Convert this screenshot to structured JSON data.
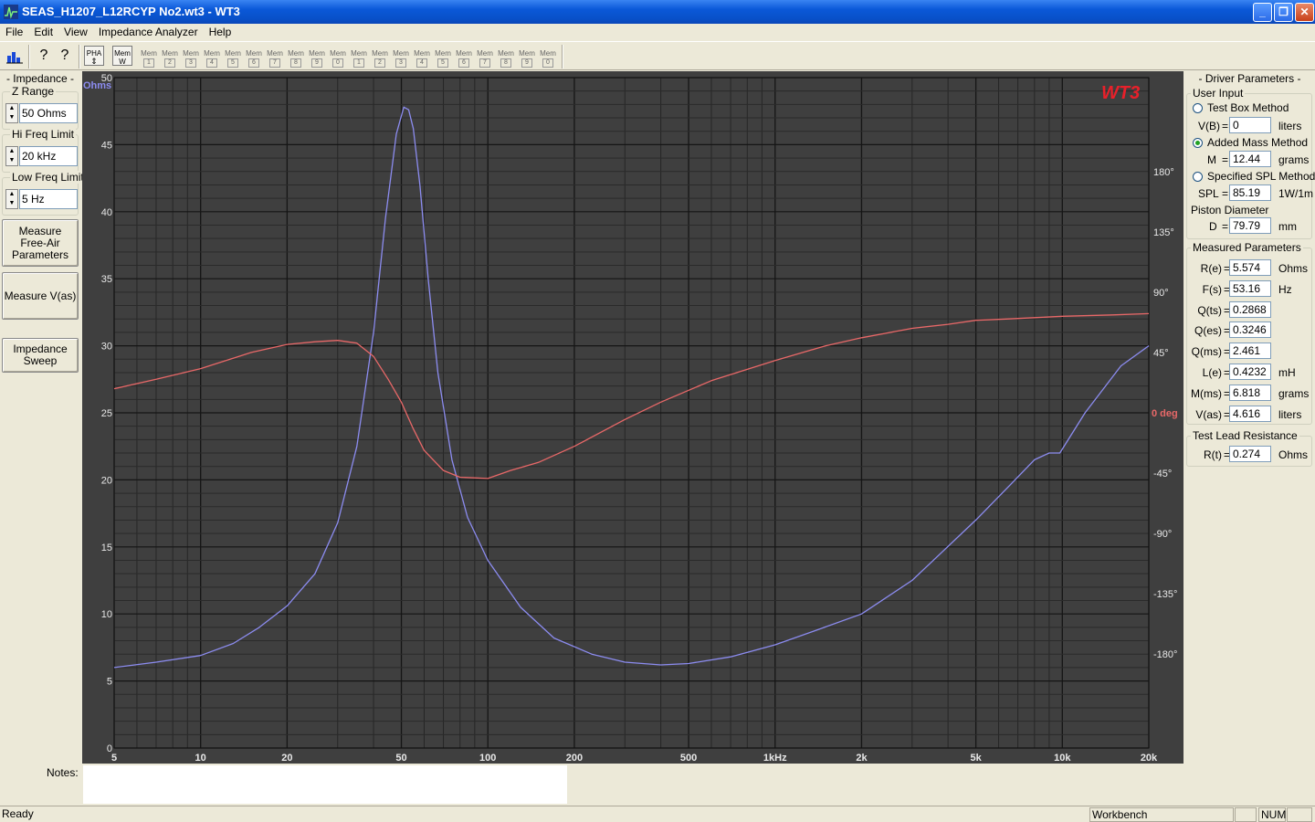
{
  "window": {
    "title": "SEAS_H1207_L12RCYP No2.wt3 - WT3",
    "controls": {
      "minimize": "_",
      "maximize": "❐",
      "close": "✕"
    }
  },
  "menu": [
    "File",
    "Edit",
    "View",
    "Impedance Analyzer",
    "Help"
  ],
  "toolbar": {
    "buttons": [
      {
        "name": "chart-icon",
        "label": ""
      },
      {
        "name": "help-icon",
        "label": "?"
      },
      {
        "name": "context-help-icon",
        "label": "?"
      }
    ],
    "pha_label": "PHA",
    "mem_w_label": "Mem",
    "mem_w_sub": "W",
    "mem_prefix": "Mem",
    "mem_slots": [
      "1",
      "2",
      "3",
      "4",
      "5",
      "6",
      "7",
      "8",
      "9",
      "0",
      "1",
      "2",
      "3",
      "4",
      "5",
      "6",
      "7",
      "8",
      "9",
      "0"
    ]
  },
  "left_panel": {
    "title": "- Impedance -",
    "z_range": {
      "label": "Z Range",
      "value": "50 Ohms"
    },
    "hi_freq": {
      "label": "Hi Freq Limit",
      "value": "20 kHz"
    },
    "low_freq": {
      "label": "Low Freq Limit",
      "value": "5 Hz"
    },
    "btn_free_air": "Measure\nFree-Air\nParameters",
    "btn_vas": "Measure V(as)",
    "btn_sweep": "Impedance\nSweep"
  },
  "right_panel": {
    "title": "- Driver Parameters -",
    "user_input": {
      "label": "User Input",
      "test_box": {
        "label": "Test Box Method",
        "selected": false,
        "field": "V(B)",
        "value": "0",
        "unit": "liters"
      },
      "added_mass": {
        "label": "Added Mass Method",
        "selected": true,
        "field": "M",
        "value": "12.44",
        "unit": "grams"
      },
      "specified_spl": {
        "label": "Specified SPL Method",
        "selected": false,
        "field": "SPL",
        "value": "85.19",
        "unit": "1W/1m"
      },
      "piston_label": "Piston Diameter",
      "piston": {
        "field": "D",
        "value": "79.79",
        "unit": "mm"
      }
    },
    "measured": {
      "label": "Measured Parameters",
      "params": [
        {
          "name": "R(e)",
          "value": "5.574",
          "unit": "Ohms"
        },
        {
          "name": "F(s)",
          "value": "53.16",
          "unit": "Hz"
        },
        {
          "name": "Q(ts)",
          "value": "0.2868",
          "unit": ""
        },
        {
          "name": "Q(es)",
          "value": "0.3246",
          "unit": ""
        },
        {
          "name": "Q(ms)",
          "value": "2.461",
          "unit": ""
        },
        {
          "name": "L(e)",
          "value": "0.4232",
          "unit": "mH"
        },
        {
          "name": "M(ms)",
          "value": "6.818",
          "unit": "grams"
        },
        {
          "name": "V(as)",
          "value": "4.616",
          "unit": "liters"
        }
      ]
    },
    "lead": {
      "label": "Test Lead Resistance",
      "field": "R(t)",
      "value": "0.274",
      "unit": "Ohms"
    }
  },
  "notes": {
    "label": "Notes:",
    "value": ""
  },
  "status": {
    "text": "Ready",
    "workbench": "Workbench",
    "num": "NUM"
  },
  "colors": {
    "impedance": "#8c8cf0",
    "phase": "#e86868",
    "plot_bg": "#3f3f3f",
    "grid": "#1e1e1e",
    "logo": "#e8202a"
  },
  "chart_data": {
    "type": "line",
    "logo": "WT3",
    "y_unit_label": "Ohms",
    "y2_unit_label": "0 deg",
    "xscale": "log",
    "xlim": [
      5,
      20000
    ],
    "ylim": [
      0,
      50
    ],
    "y2lim": [
      -250,
      250
    ],
    "x_ticks": [
      5,
      10,
      20,
      50,
      100,
      200,
      500,
      1000,
      2000,
      5000,
      10000,
      20000
    ],
    "x_tick_labels": [
      "5",
      "10",
      "20",
      "50",
      "100",
      "200",
      "500",
      "1kHz",
      "2k",
      "5k",
      "10k",
      "20k"
    ],
    "y_ticks": [
      0,
      5,
      10,
      15,
      20,
      25,
      30,
      35,
      40,
      45,
      50
    ],
    "y2_ticks": [
      180,
      135,
      90,
      45,
      -45,
      -90,
      -135,
      -180
    ],
    "y2_tick_labels": [
      "180°",
      "135°",
      "90°",
      "45°",
      "-45°",
      "-90°",
      "-135°",
      "-180°"
    ],
    "grid": true,
    "series": [
      {
        "id": "impedance",
        "axis": "left",
        "x": [
          5,
          7,
          10,
          13,
          16,
          20,
          25,
          30,
          35,
          40,
          44,
          48,
          51,
          53,
          55,
          58,
          62,
          67,
          75,
          85,
          100,
          130,
          170,
          230,
          300,
          400,
          500,
          700,
          1000,
          1400,
          2000,
          3000,
          5000,
          6500,
          8000,
          9000,
          9800,
          12000,
          16000,
          20000
        ],
        "y": [
          6.0,
          6.4,
          6.9,
          7.8,
          9.0,
          10.6,
          13.0,
          16.8,
          22.5,
          31.0,
          39.5,
          45.8,
          47.8,
          47.6,
          46.2,
          42.0,
          35.0,
          28.0,
          21.5,
          17.2,
          14.0,
          10.5,
          8.2,
          7.0,
          6.4,
          6.2,
          6.3,
          6.8,
          7.7,
          8.8,
          10.0,
          12.5,
          17.0,
          19.5,
          21.5,
          22.0,
          22.0,
          25.0,
          28.5,
          30.0
        ]
      },
      {
        "id": "phase",
        "axis": "right",
        "x": [
          5,
          7,
          10,
          15,
          20,
          25,
          30,
          35,
          40,
          45,
          50,
          55,
          60,
          70,
          80,
          100,
          120,
          150,
          200,
          300,
          400,
          600,
          1000,
          1500,
          2000,
          3000,
          4000,
          5000,
          6500,
          8000,
          10000,
          15000,
          20000
        ],
        "y": [
          18,
          25,
          33,
          45,
          51,
          53,
          54,
          52,
          42,
          25,
          8,
          -12,
          -28,
          -43,
          -48,
          -49,
          -43,
          -37,
          -25,
          -5,
          8,
          24,
          39,
          50,
          56,
          63,
          66,
          69,
          70,
          71,
          72,
          73,
          74
        ]
      }
    ]
  }
}
